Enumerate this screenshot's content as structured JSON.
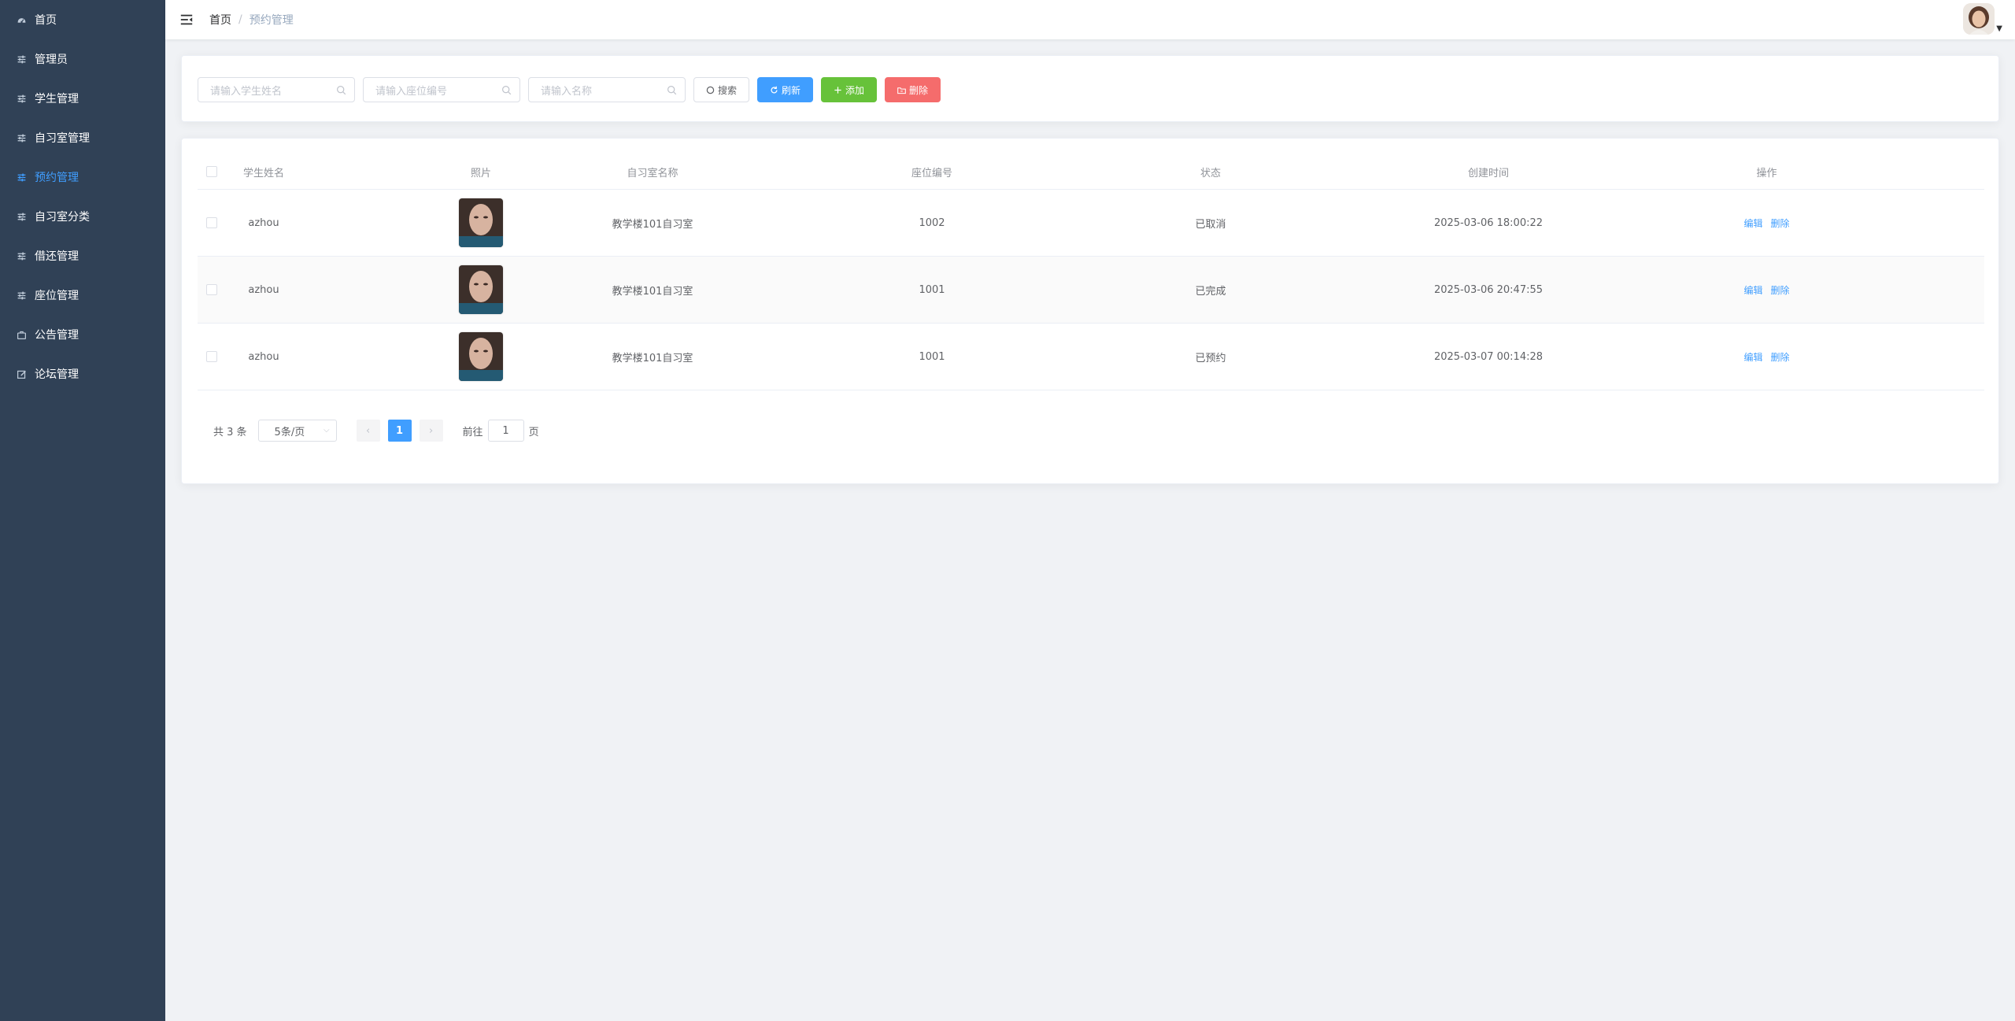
{
  "sidebar": {
    "items": [
      {
        "label": "首页",
        "icon": "dashboard-icon",
        "active": false
      },
      {
        "label": "管理员",
        "icon": "sliders-icon",
        "active": false
      },
      {
        "label": "学生管理",
        "icon": "sliders-icon",
        "active": false
      },
      {
        "label": "自习室管理",
        "icon": "sliders-icon",
        "active": false
      },
      {
        "label": "预约管理",
        "icon": "sliders-icon",
        "active": true
      },
      {
        "label": "自习室分类",
        "icon": "sliders-icon",
        "active": false
      },
      {
        "label": "借还管理",
        "icon": "sliders-icon",
        "active": false
      },
      {
        "label": "座位管理",
        "icon": "sliders-icon",
        "active": false
      },
      {
        "label": "公告管理",
        "icon": "briefcase-icon",
        "active": false
      },
      {
        "label": "论坛管理",
        "icon": "edit-icon",
        "active": false
      }
    ]
  },
  "header": {
    "breadcrumb_home": "首页",
    "breadcrumb_sep": "/",
    "breadcrumb_current": "预约管理"
  },
  "search": {
    "student_placeholder": "请输入学生姓名",
    "seat_placeholder": "请输入座位编号",
    "name_placeholder": "请输入名称",
    "search_label": "搜索",
    "refresh_label": "刷新",
    "add_label": "添加",
    "delete_label": "删除"
  },
  "table": {
    "columns": [
      "学生姓名",
      "照片",
      "自习室名称",
      "座位编号",
      "状态",
      "创建时间",
      "操作"
    ],
    "rows": [
      {
        "student": "azhou",
        "room": "教学楼101自习室",
        "seat": "1002",
        "status": "已取消",
        "created": "2025-03-06 18:00:22"
      },
      {
        "student": "azhou",
        "room": "教学楼101自习室",
        "seat": "1001",
        "status": "已完成",
        "created": "2025-03-06 20:47:55"
      },
      {
        "student": "azhou",
        "room": "教学楼101自习室",
        "seat": "1001",
        "status": "已预约",
        "created": "2025-03-07 00:14:28"
      }
    ],
    "edit_label": "编辑",
    "delete_label": "删除"
  },
  "pagination": {
    "total_text": "共 3 条",
    "page_size": "5条/页",
    "current_page": "1",
    "goto_prefix": "前往",
    "goto_value": "1",
    "goto_suffix": "页"
  },
  "colors": {
    "sidebar_bg": "#304156",
    "active": "#409eff",
    "add": "#67c23a",
    "delete": "#f56c6c"
  }
}
